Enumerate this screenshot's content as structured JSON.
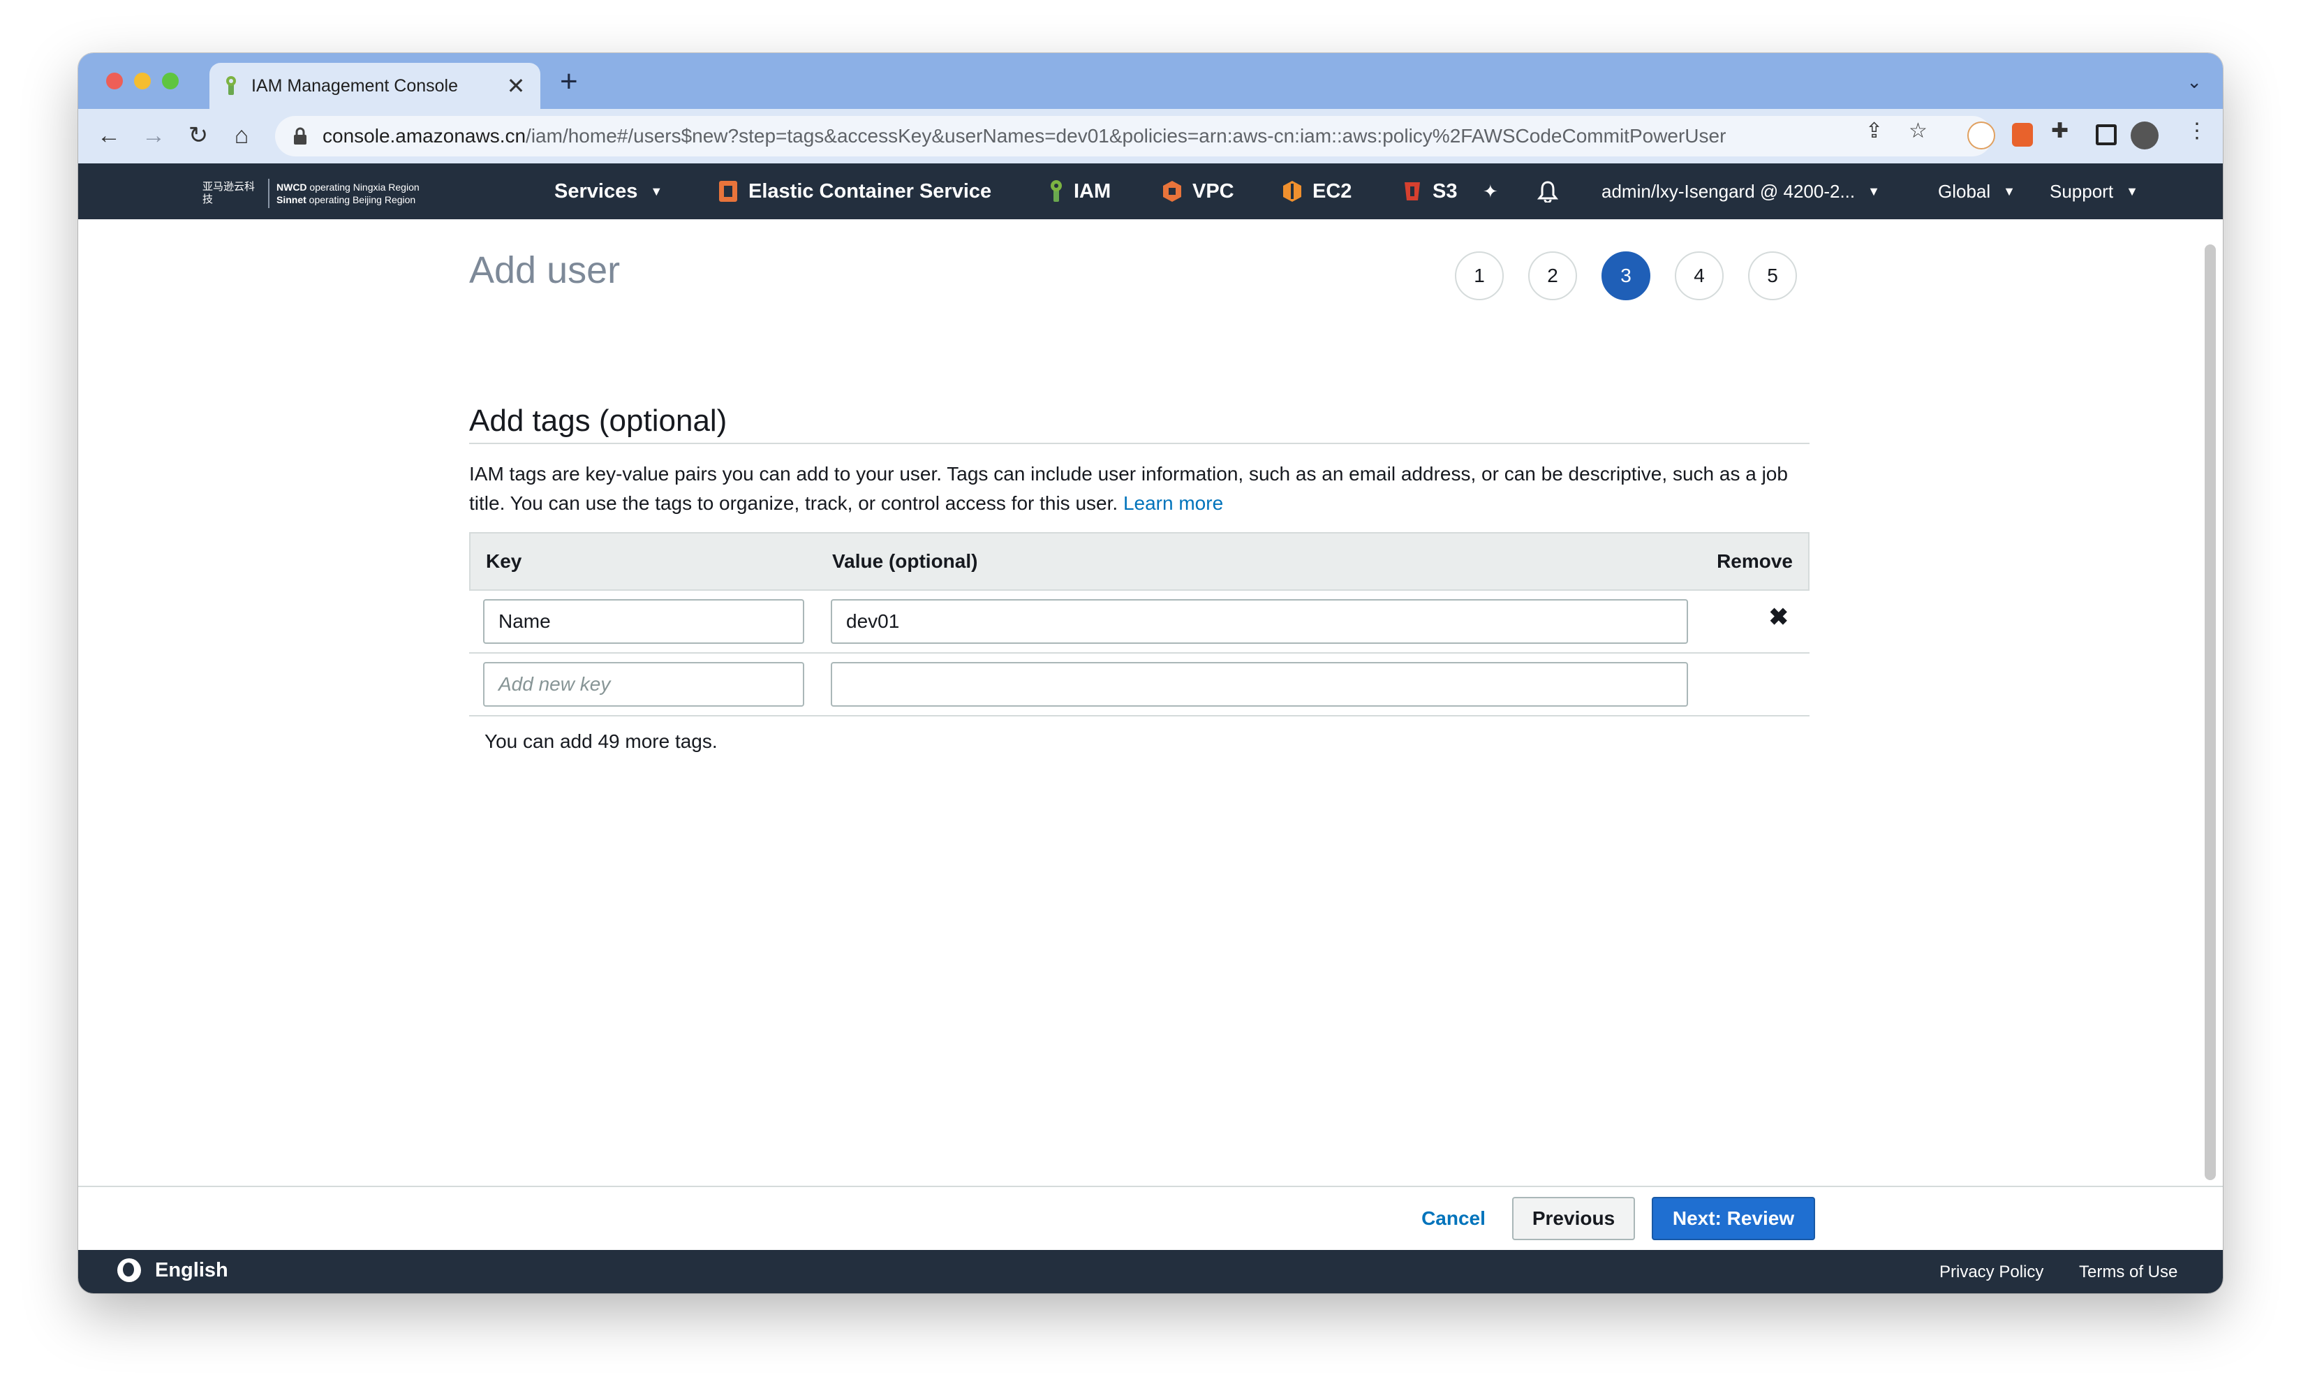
{
  "browser": {
    "tab_title": "IAM Management Console",
    "tab_close": "✕",
    "new_tab": "+",
    "url_host": "console.amazonaws.cn",
    "url_path": "/iam/home#/users$new?step=tags&accessKey&userNames=dev01&policies=arn:aws-cn:iam::aws:policy%2FAWSCodeCommitPowerUser"
  },
  "awsnav": {
    "logo_cn": "亚马逊云科技",
    "region_line1_bold": "NWCD",
    "region_line1": " operating Ningxia Region",
    "region_line2_bold": "Sinnet",
    "region_line2": " operating Beijing Region",
    "services_label": "Services",
    "shortcuts": [
      "Elastic Container Service",
      "IAM",
      "VPC",
      "EC2",
      "S3"
    ],
    "account_label": "admin/lxy-Isengard @ 4200-2...",
    "region_label": "Global",
    "support_label": "Support"
  },
  "page": {
    "title": "Add user",
    "steps": [
      "1",
      "2",
      "3",
      "4",
      "5"
    ],
    "active_step": "3",
    "section_title": "Add tags (optional)",
    "description": "IAM tags are key-value pairs you can add to your user. Tags can include user information, such as an email address, or can be descriptive, such as a job title. You can use the tags to organize, track, or control access for this user.",
    "learn_more": "Learn more",
    "table": {
      "col_key": "Key",
      "col_value": "Value (optional)",
      "col_remove": "Remove",
      "rows": [
        {
          "key": "Name",
          "value": "dev01"
        }
      ],
      "new_key_placeholder": "Add new key"
    },
    "remaining_text": "You can add 49 more tags."
  },
  "actions": {
    "cancel": "Cancel",
    "previous": "Previous",
    "next": "Next: Review"
  },
  "footer": {
    "language": "English",
    "privacy": "Privacy Policy",
    "terms": "Terms of Use"
  },
  "colors": {
    "nav_bg": "#232f3e",
    "primary": "#1f6fd1",
    "link": "#0073bb",
    "active_step": "#1f5fb7"
  }
}
